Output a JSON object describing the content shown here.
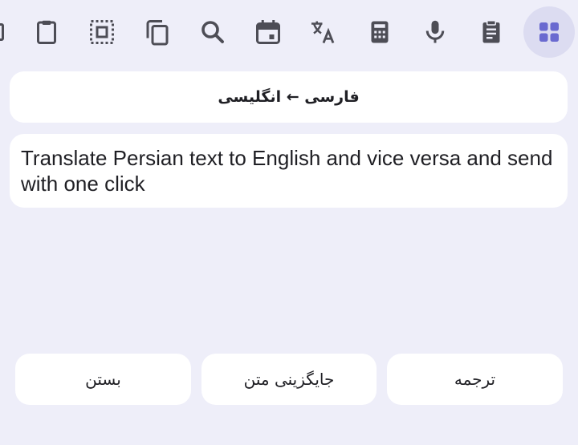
{
  "toolbar": {
    "items": [
      {
        "icon": "clipboard-icon"
      },
      {
        "icon": "select-all-icon"
      },
      {
        "icon": "copy-icon"
      },
      {
        "icon": "search-icon"
      },
      {
        "icon": "calendar-icon"
      },
      {
        "icon": "translate-icon"
      },
      {
        "icon": "calculator-icon"
      },
      {
        "icon": "microphone-icon"
      },
      {
        "icon": "clipboard-text-icon"
      },
      {
        "icon": "grid-apps-icon",
        "active": true
      }
    ],
    "icon_color": "#4d4d56",
    "active_icon_color": "#6a6ad0"
  },
  "language": {
    "label": "فارسی ← انگلیسی"
  },
  "input": {
    "text": "Translate Persian text to English and vice versa and send with one click"
  },
  "actions": {
    "close_label": "بستن",
    "replace_label": "جایگزینی متن",
    "translate_label": "ترجمه"
  },
  "colors": {
    "background": "#eeeef9",
    "card": "#ffffff",
    "active_icon_bg": "#dcdcf1"
  }
}
